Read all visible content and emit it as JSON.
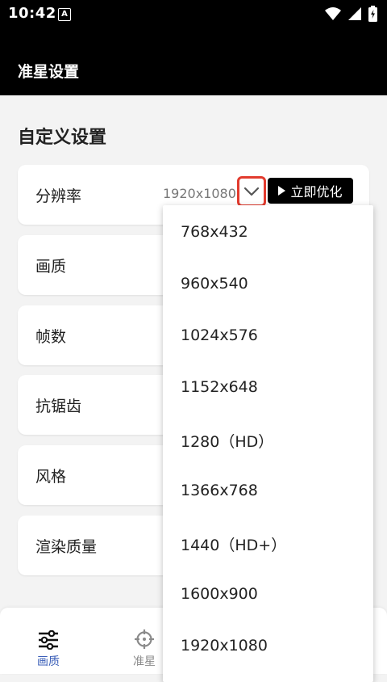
{
  "status_bar": {
    "time": "10:42",
    "notification_letter": "A"
  },
  "app_bar": {
    "title": "准星设置"
  },
  "section": {
    "title": "自定义设置"
  },
  "settings": [
    {
      "label": "分辨率",
      "value": "1920x1080"
    },
    {
      "label": "画质"
    },
    {
      "label": "帧数"
    },
    {
      "label": "抗锯齿"
    },
    {
      "label": "风格"
    },
    {
      "label": "渲染质量"
    }
  ],
  "optimize_button": {
    "label": "立即优化"
  },
  "dropdown": {
    "options": [
      "768x432",
      "960x540",
      "1024x576",
      "1152x648",
      "1280（HD）",
      "1366x768",
      "1440（HD+）",
      "1600x900",
      "1920x1080"
    ]
  },
  "bottom_nav": {
    "items": [
      {
        "label": "画质",
        "icon": "sliders-icon",
        "active": true
      },
      {
        "label": "准星",
        "icon": "crosshair-icon",
        "active": false
      }
    ]
  },
  "colors": {
    "accent_blue": "#3b5fb8",
    "highlight_red": "#e23b2e",
    "header_bg": "#000000",
    "inactive_gray": "#8a8a8a"
  }
}
